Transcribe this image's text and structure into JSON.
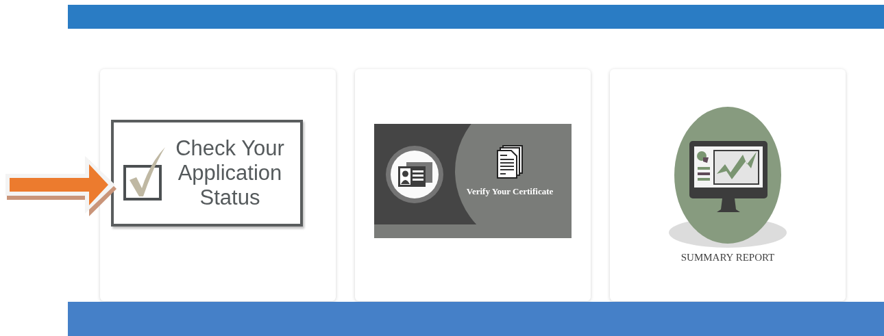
{
  "cards": [
    {
      "kind": "application-status",
      "label": "Check Your Application Status"
    },
    {
      "kind": "certificate",
      "label": "Verify Your Certificate"
    },
    {
      "kind": "summary",
      "label": "SUMMARY REPORT"
    }
  ]
}
